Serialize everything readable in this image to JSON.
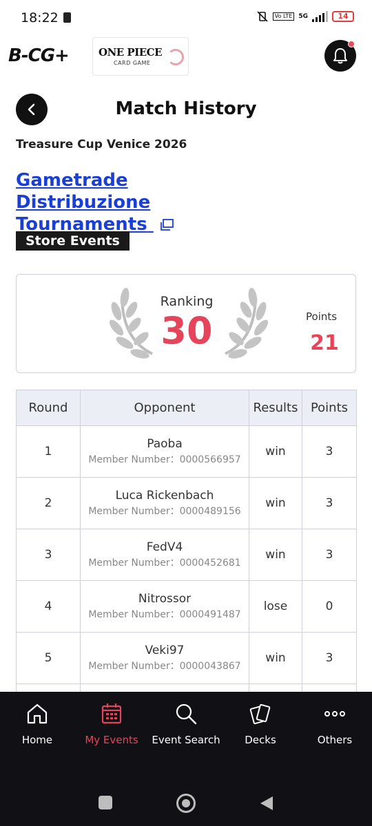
{
  "status": {
    "time": "18:22",
    "volte": "Vo LTE",
    "network": "5G",
    "battery": "14"
  },
  "header": {
    "brand_logo": "B-CG+",
    "game_logo_title": "ONE PIECE",
    "game_logo_sub": "CARD GAME",
    "bell_icon": "bell-icon"
  },
  "page": {
    "title": "Match History",
    "event_name": "Treasure Cup Venice 2026",
    "store_name": "Gametrade Distribuzione Tournaments",
    "event_type_badge": "Store Events"
  },
  "ranking": {
    "ranking_label": "Ranking",
    "ranking_value": "30",
    "points_label": "Points",
    "points_value": "21"
  },
  "table": {
    "headers": [
      "Round",
      "Opponent",
      "Results",
      "Points"
    ],
    "rows": [
      {
        "round": "1",
        "opponent": "Paoba",
        "member": "Member Number：0000566957",
        "result": "win",
        "points": "3"
      },
      {
        "round": "2",
        "opponent": "Luca Rickenbach",
        "member": "Member Number：0000489156",
        "result": "win",
        "points": "3"
      },
      {
        "round": "3",
        "opponent": "FedV4",
        "member": "Member Number：0000452681",
        "result": "win",
        "points": "3"
      },
      {
        "round": "4",
        "opponent": "Nitrossor",
        "member": "Member Number：0000491487",
        "result": "lose",
        "points": "0"
      },
      {
        "round": "5",
        "opponent": "Veki97",
        "member": "Member Number：0000043867",
        "result": "win",
        "points": "3"
      }
    ]
  },
  "nav": {
    "items": [
      {
        "label": "Home",
        "icon": "home-icon"
      },
      {
        "label": "My Events",
        "icon": "calendar-icon"
      },
      {
        "label": "Event Search",
        "icon": "search-icon"
      },
      {
        "label": "Decks",
        "icon": "cards-icon"
      },
      {
        "label": "Others",
        "icon": "more-icon"
      }
    ],
    "active_index": 1
  },
  "colors": {
    "accent": "#e5455a",
    "link": "#1a3fd6",
    "nav_bg": "#111115"
  }
}
